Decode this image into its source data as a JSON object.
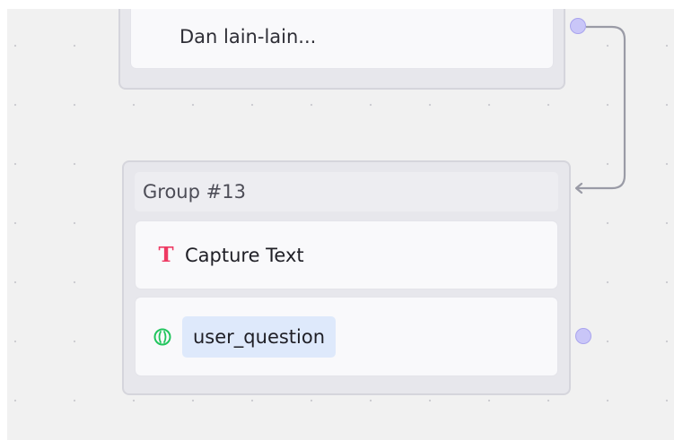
{
  "flow": {
    "top_block": {
      "text": "Dan lain-lain..."
    },
    "group": {
      "title": "Group #13",
      "capture_row": {
        "icon": "text-t-icon",
        "label": "Capture Text"
      },
      "variable_row": {
        "icon": "variable-icon",
        "variable": "user_question"
      }
    }
  },
  "colors": {
    "canvas": "#f1f1f1",
    "port": "#c9c6f8",
    "edge": "#9a9ba6",
    "text_icon": "#ee3a63",
    "variable_icon": "#22c55e",
    "chip": "#dee9fb"
  }
}
